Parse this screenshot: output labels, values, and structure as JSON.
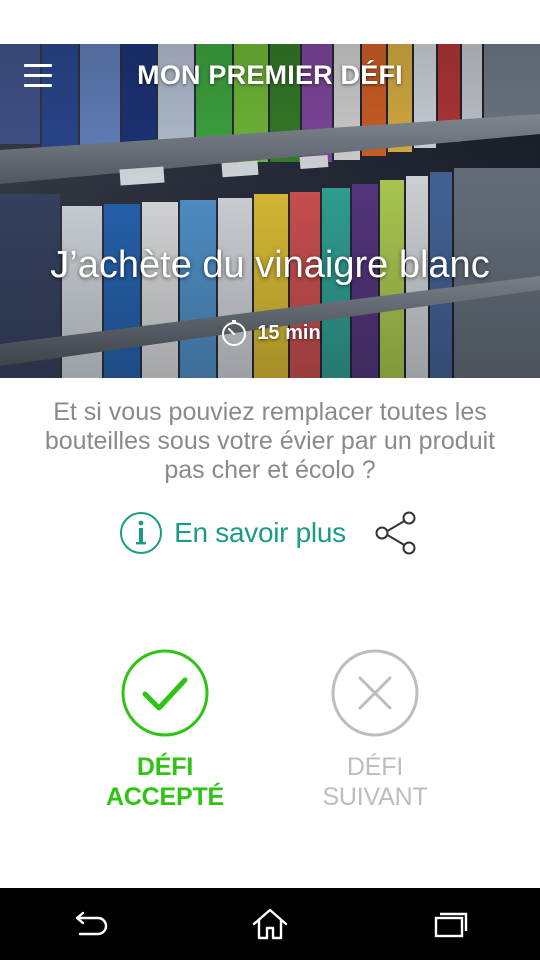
{
  "header": {
    "title": "MON PREMIER DÉFI",
    "menu_icon": "hamburger-menu-icon"
  },
  "challenge": {
    "title": "J’achète du vinaigre blanc",
    "duration": "15 min",
    "duration_icon": "stopwatch-icon",
    "description": "Et si vous pouviez remplacer toutes les bouteilles sous votre évier par un produit pas cher et écolo ?"
  },
  "more_info": {
    "label": "En savoir plus",
    "icon": "info-circle-icon",
    "share_icon": "share-icon"
  },
  "actions": {
    "accept": {
      "label_line1": "DÉFI",
      "label_line2": "ACCEPTÉ",
      "icon": "check-circle-icon",
      "color": "#2ec414"
    },
    "next": {
      "label_line1": "DÉFI",
      "label_line2": "SUIVANT",
      "icon": "close-circle-icon",
      "color": "#bdbdbd"
    }
  },
  "colors": {
    "accent": "#1a9b86",
    "accept_green": "#2ec414",
    "muted_text": "#8a8a8a"
  },
  "navigation": {
    "back_icon": "back-arrow-icon",
    "home_icon": "home-icon",
    "recents_icon": "recent-apps-icon"
  }
}
